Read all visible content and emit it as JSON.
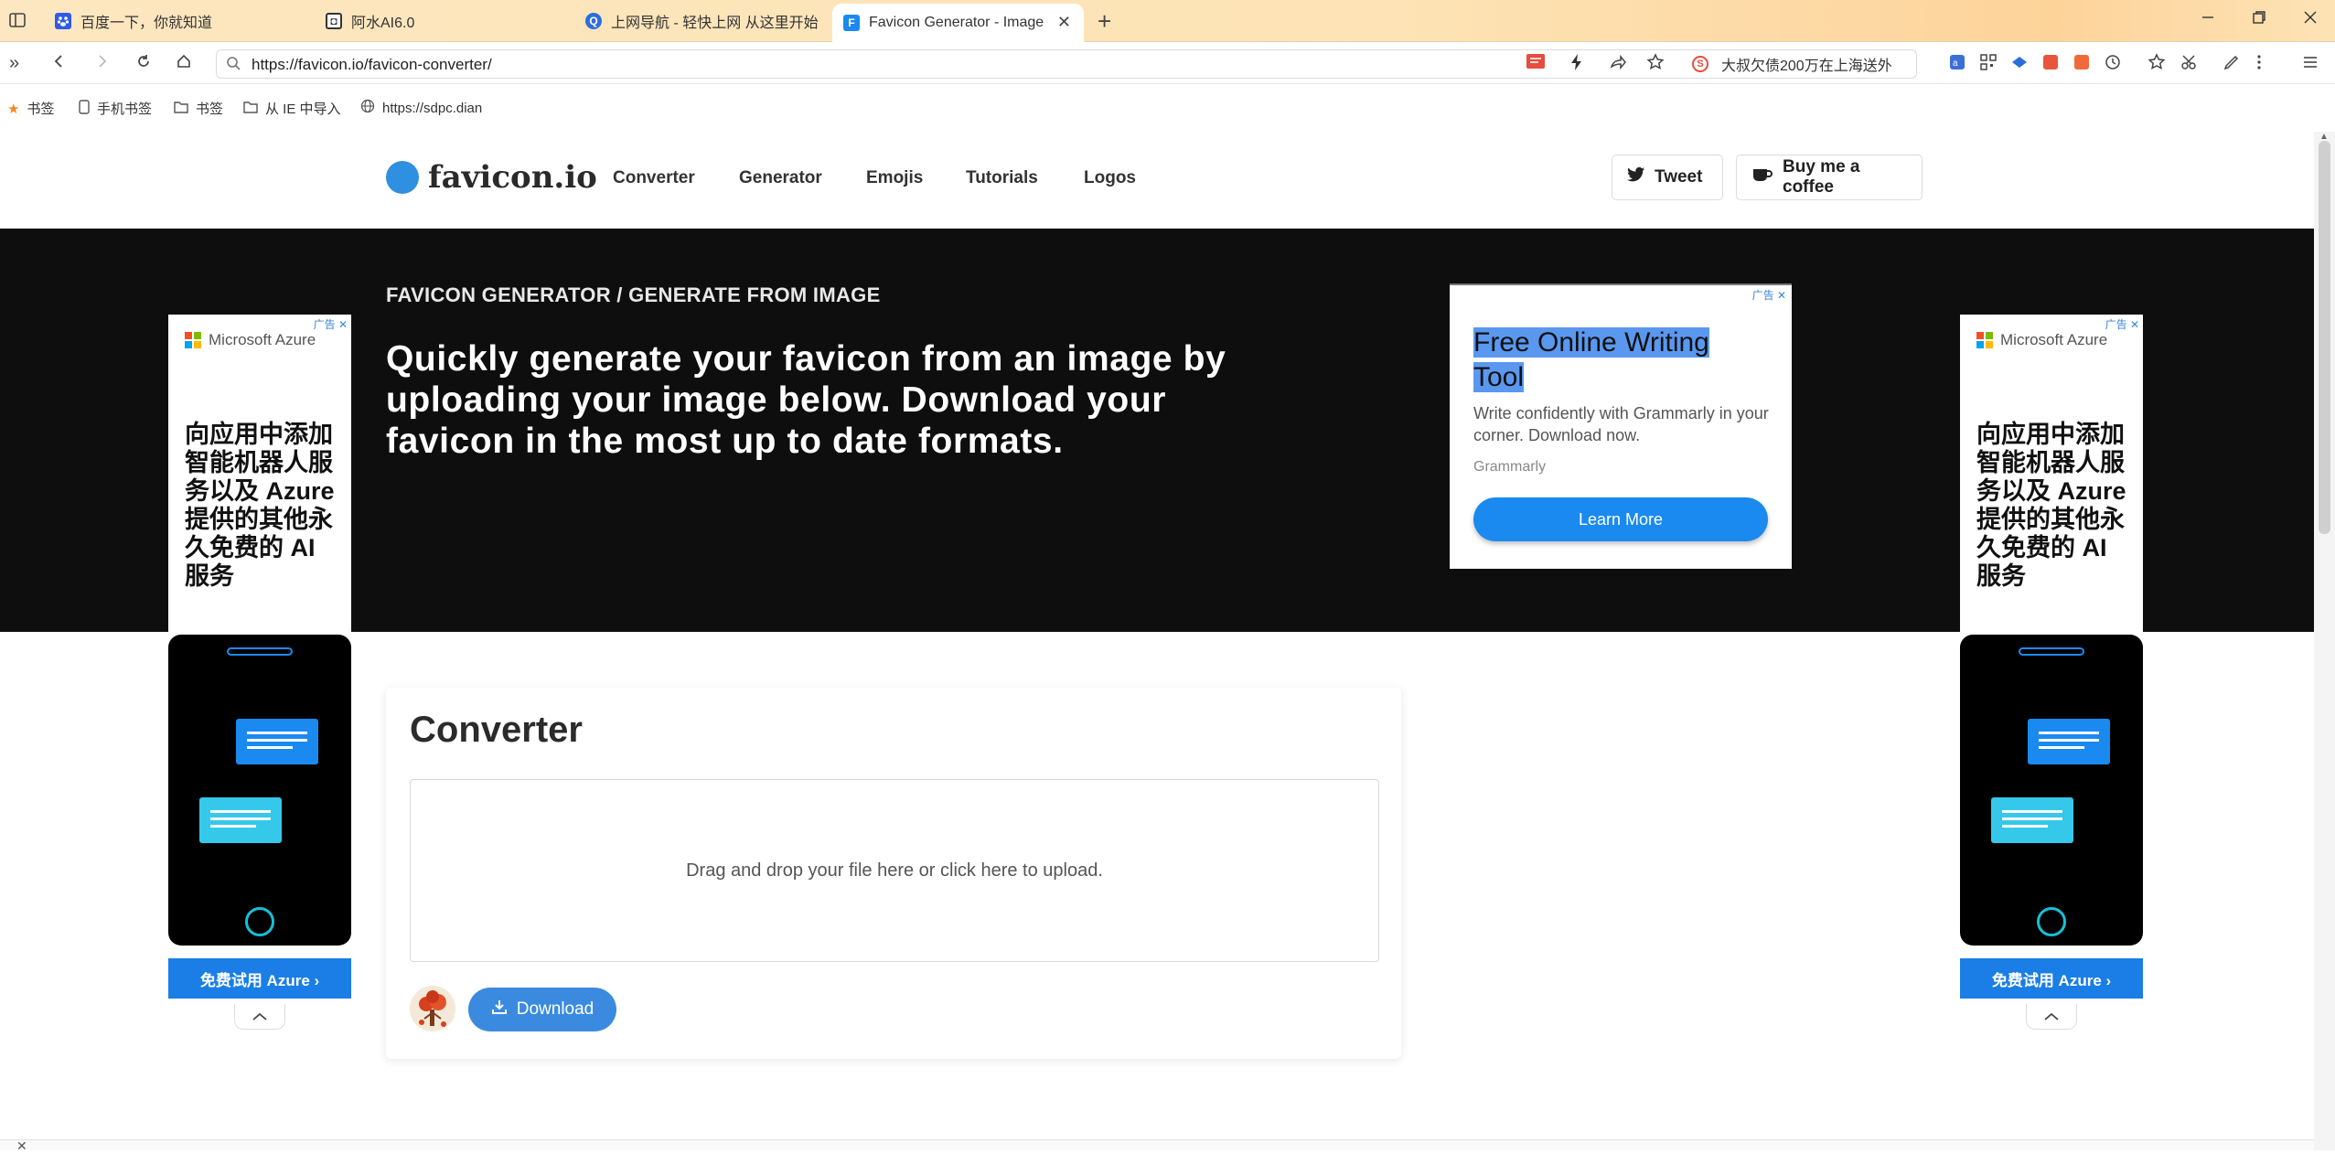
{
  "browser": {
    "tabs": [
      {
        "title": "百度一下，你就知道",
        "favicon_color": "#2f5be8"
      },
      {
        "title": "阿水AI6.0",
        "favicon_color": "#333333"
      },
      {
        "title": "上网导航 - 轻快上网 从这里开始",
        "favicon_color": "#2e6de0"
      },
      {
        "title": "Favicon Generator - Image",
        "favicon_color": "#1a8af0",
        "active": true
      }
    ],
    "new_tab_symbol": "+",
    "close_tab_symbol": "✕",
    "url": "https://favicon.io/favicon-converter/",
    "hot_search": "大叔欠债200万在上海送外",
    "bookmarks": [
      {
        "label": "书签",
        "icon": "star-icon"
      },
      {
        "label": "手机书签",
        "icon": "phone-icon"
      },
      {
        "label": "书签",
        "icon": "folder-icon"
      },
      {
        "label": "从 IE 中导入",
        "icon": "folder-icon"
      },
      {
        "label": "https://sdpc.dian",
        "icon": "globe-icon"
      }
    ]
  },
  "site": {
    "logo_text": "favicon.io",
    "nav": [
      "Converter",
      "Generator",
      "Emojis",
      "Tutorials",
      "Logos"
    ],
    "tweet_label": "Tweet",
    "coffee_label": "Buy me a coffee",
    "breadcrumb": "FAVICON GENERATOR / GENERATE FROM IMAGE",
    "hero_title": "Quickly generate your favicon from an image by uploading your image below. Download your favicon in the most up to date formats.",
    "accent_color": "#2f8fe0",
    "hero_bg": "#0e0e0e"
  },
  "ads": {
    "badge": "广告",
    "grammarly": {
      "title_line1": "Free Online Writing",
      "title_line2": "Tool",
      "desc": "Write confidently with Grammarly in your corner. Download now.",
      "brand": "Grammarly",
      "button": "Learn More"
    },
    "azure": {
      "brand": "Microsoft Azure",
      "text": "向应用中添加智能机器人服务以及 Azure 提供的其他永久免费的 AI 服务",
      "button": "免费试用 Azure ›"
    }
  },
  "converter": {
    "title": "Converter",
    "dropzone_text": "Drag and drop your file here or click here to upload.",
    "download_label": "Download"
  }
}
